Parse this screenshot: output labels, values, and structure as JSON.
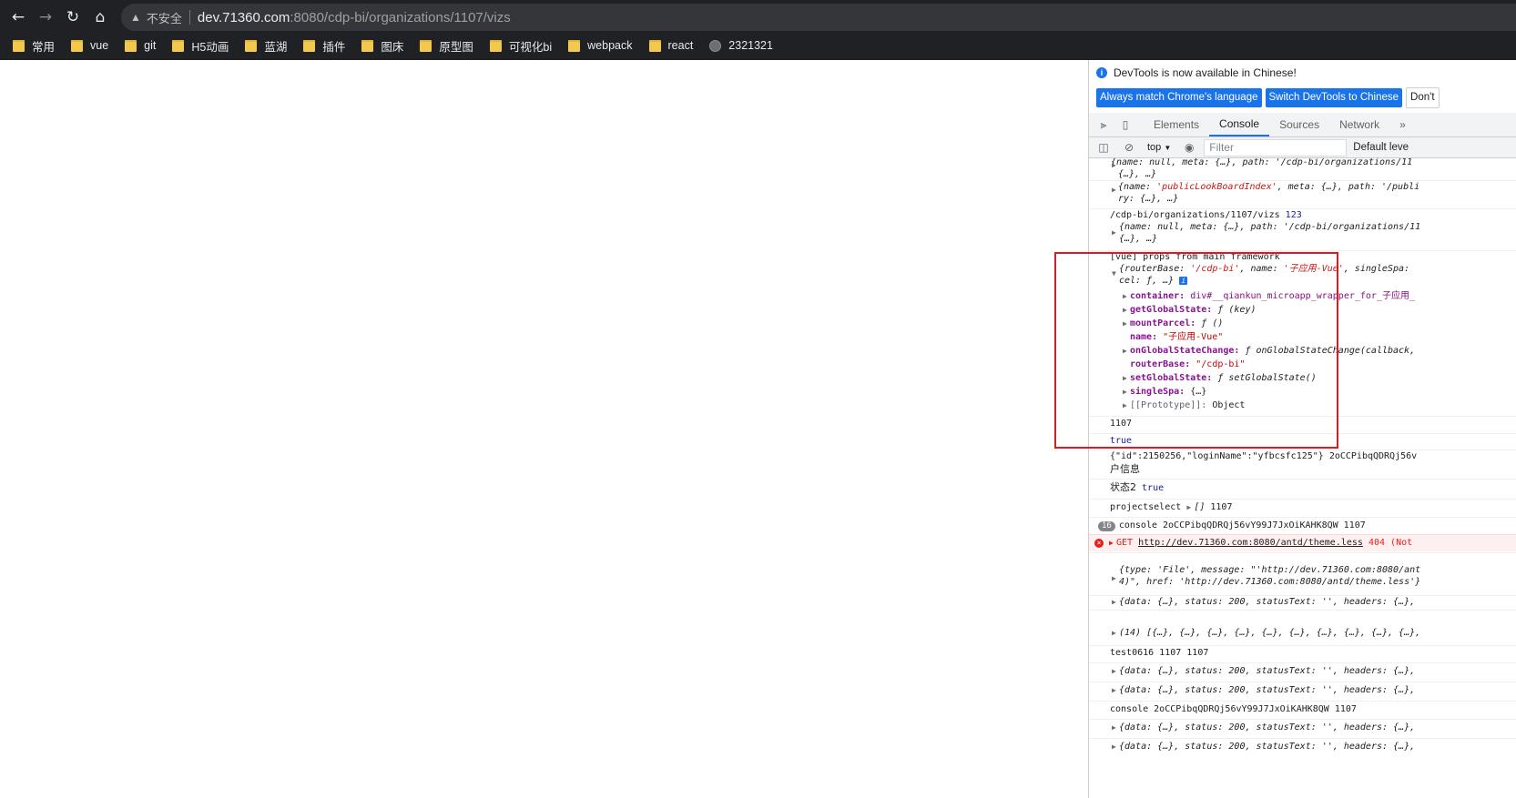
{
  "browser": {
    "security_label": "不安全",
    "url_host": "dev.71360.com",
    "url_rest": ":8080/cdp-bi/organizations/1107/vizs",
    "bookmarks": [
      "常用",
      "vue",
      "git",
      "H5动画",
      "蓝湖",
      "插件",
      "图床",
      "原型图",
      "可视化bi",
      "webpack",
      "react",
      "2321321"
    ]
  },
  "devtools": {
    "infobar_text": "DevTools is now available in Chinese!",
    "buttons": [
      "Always match Chrome's language",
      "Switch DevTools to Chinese",
      "Don't"
    ],
    "tabs": [
      "Elements",
      "Console",
      "Sources",
      "Network"
    ],
    "context": "top",
    "filter_placeholder": "Filter",
    "levels": "Default leve"
  },
  "console": {
    "l1a": "{name: null, meta: {…}, path: '/cdp-bi/organizations/11",
    "l1b": "{…}, …}",
    "l2_name": "'publicLookBoardIndex'",
    "l2_rest": ", meta: {…}, path: '/publi",
    "l2b": "ry: {…}, …}",
    "l3_path": "/cdp-bi/organizations/1107/vizs",
    "l3_num": "123",
    "l4a": "{name: null, meta: {…}, path: '/cdp-bi/organizations/11",
    "l4b": "{…}, …}",
    "l5": "[vue] props from main framework",
    "l6a_routerBase": "'/cdp-bi'",
    "l6a_name": "'子应用-Vue'",
    "l6a_tail": ", singleSpa:",
    "l6b": "cel: ƒ, …}",
    "props": {
      "container_key": "container:",
      "container_val": "div#__qiankun_microapp_wrapper_for_子应用_",
      "getGlobalState_key": "getGlobalState:",
      "getGlobalState_val": "ƒ (key)",
      "mountParcel_key": "mountParcel:",
      "mountParcel_val": "ƒ ()",
      "name_key": "name:",
      "name_val": "\"子应用-Vue\"",
      "onGlobalStateChange_key": "onGlobalStateChange:",
      "onGlobalStateChange_val": "ƒ onGlobalStateChange(callback,",
      "routerBase_key": "routerBase:",
      "routerBase_val": "\"/cdp-bi\"",
      "setGlobalState_key": "setGlobalState:",
      "setGlobalState_val": "ƒ setGlobalState()",
      "singleSpa_key": "singleSpa:",
      "singleSpa_val": "{…}",
      "prototype_key": "[[Prototype]]:",
      "prototype_val": "Object"
    },
    "l7": "1107",
    "l8": "true",
    "l9": "{\"id\":2150256,\"loginName\":\"yfbcsfc125\"} 2oCCPibqQDRQj56v",
    "l9b": "户信息",
    "l10_label": "状态2",
    "l10_val": "true",
    "l11_label": "projectselect",
    "l11_arr": "[]",
    "l11_num": "1107",
    "l12_count": "16",
    "l12": "console 2oCCPibqQDRQj56vY99J7JxOiKAHK8QW 1107",
    "l13_method": "GET",
    "l13_url": "http://dev.71360.com:8080/antd/theme.less",
    "l13_status": "404 (Not",
    "l14a": "{type: 'File', message: \"'http://dev.71360.com:8080/ant",
    "l14b": "4)\", href: 'http://dev.71360.com:8080/antd/theme.less'}",
    "resp": "{data: {…}, status: 200, statusText: '', headers: {…},",
    "l16": "(14) [{…}, {…}, {…}, {…}, {…}, {…}, {…}, {…}, {…}, {…},",
    "l17": "test0616 1107 1107",
    "l20": "console 2oCCPibqQDRQj56vY99J7JxOiKAHK8QW 1107"
  }
}
